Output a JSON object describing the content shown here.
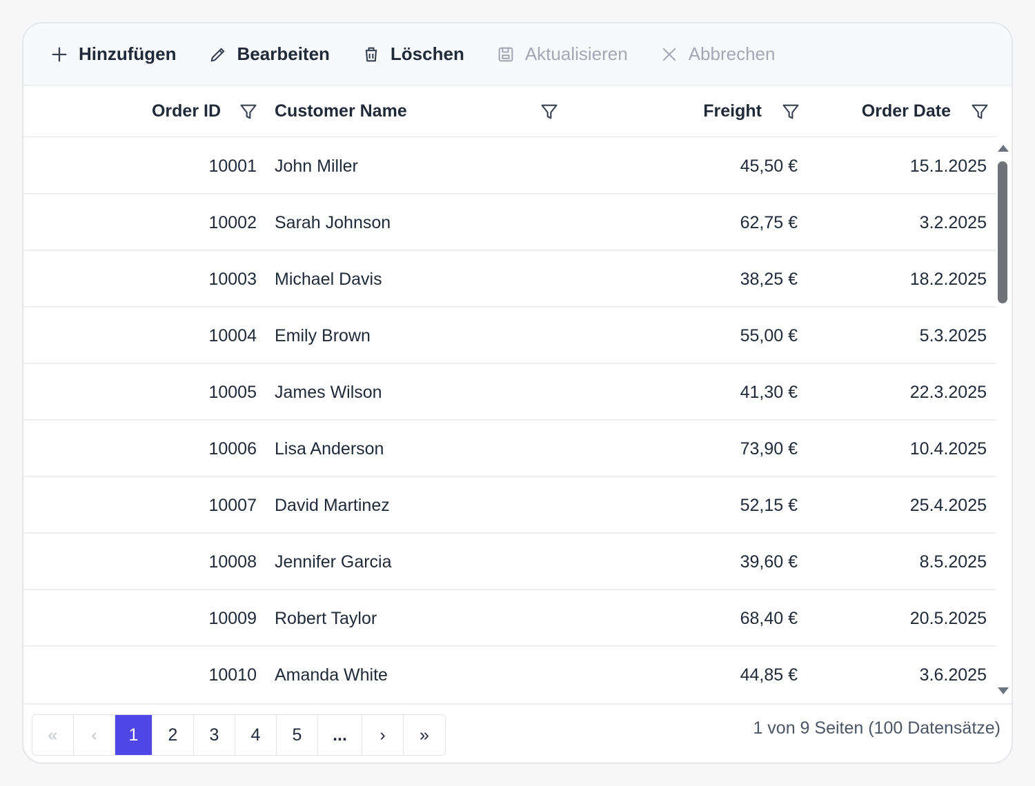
{
  "toolbar": {
    "add": "Hinzufügen",
    "edit": "Bearbeiten",
    "delete": "Löschen",
    "update": "Aktualisieren",
    "cancel": "Abbrechen"
  },
  "columns": {
    "order_id": "Order ID",
    "customer_name": "Customer Name",
    "freight": "Freight",
    "order_date": "Order Date"
  },
  "rows": [
    {
      "id": "10001",
      "name": "John Miller",
      "freight": "45,50 €",
      "date": "15.1.2025"
    },
    {
      "id": "10002",
      "name": "Sarah Johnson",
      "freight": "62,75 €",
      "date": "3.2.2025"
    },
    {
      "id": "10003",
      "name": "Michael Davis",
      "freight": "38,25 €",
      "date": "18.2.2025"
    },
    {
      "id": "10004",
      "name": "Emily Brown",
      "freight": "55,00 €",
      "date": "5.3.2025"
    },
    {
      "id": "10005",
      "name": "James Wilson",
      "freight": "41,30 €",
      "date": "22.3.2025"
    },
    {
      "id": "10006",
      "name": "Lisa Anderson",
      "freight": "73,90 €",
      "date": "10.4.2025"
    },
    {
      "id": "10007",
      "name": "David Martinez",
      "freight": "52,15 €",
      "date": "25.4.2025"
    },
    {
      "id": "10008",
      "name": "Jennifer Garcia",
      "freight": "39,60 €",
      "date": "8.5.2025"
    },
    {
      "id": "10009",
      "name": "Robert Taylor",
      "freight": "68,40 €",
      "date": "20.5.2025"
    },
    {
      "id": "10010",
      "name": "Amanda White",
      "freight": "44,85 €",
      "date": "3.6.2025"
    }
  ],
  "pager": {
    "first": "«",
    "prev": "‹",
    "pages": [
      "1",
      "2",
      "3",
      "4",
      "5"
    ],
    "dots": "...",
    "next": "›",
    "last": "»",
    "info": "1 von 9 Seiten (100 Datensätze)"
  },
  "colors": {
    "accent": "#4f46e5"
  }
}
